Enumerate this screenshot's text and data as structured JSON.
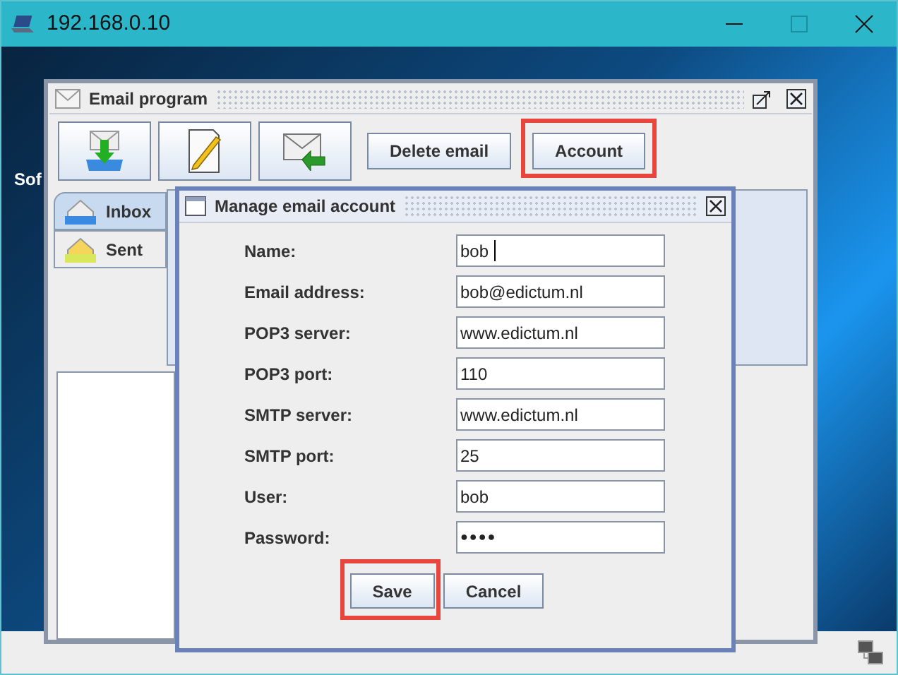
{
  "window": {
    "title": "192.168.0.10"
  },
  "desktop": {
    "label": "Sof"
  },
  "email_program": {
    "title": "Email program",
    "buttons": [
      {
        "label": "Delete email",
        "highlighted": false
      },
      {
        "label": "Account",
        "highlighted": true
      }
    ],
    "tabs": [
      {
        "label": "Inbox",
        "selected": true
      },
      {
        "label": "Sent",
        "selected": false
      }
    ]
  },
  "dialog": {
    "title": "Manage email account",
    "fields": [
      {
        "label": "Name:",
        "value": "bob",
        "focused": true
      },
      {
        "label": "Email address:",
        "value": "bob@edictum.nl",
        "focused": false
      },
      {
        "label": "POP3 server:",
        "value": "www.edictum.nl",
        "focused": false
      },
      {
        "label": "POP3 port:",
        "value": "110",
        "focused": false
      },
      {
        "label": "SMTP server:",
        "value": "www.edictum.nl",
        "focused": false
      },
      {
        "label": "SMTP port:",
        "value": "25",
        "focused": false
      },
      {
        "label": "User:",
        "value": "bob",
        "focused": false
      },
      {
        "label": "Password:",
        "value": "●●●●",
        "focused": false
      }
    ],
    "buttons": [
      {
        "label": "Save",
        "highlighted": true
      },
      {
        "label": "Cancel",
        "highlighted": false
      }
    ]
  }
}
